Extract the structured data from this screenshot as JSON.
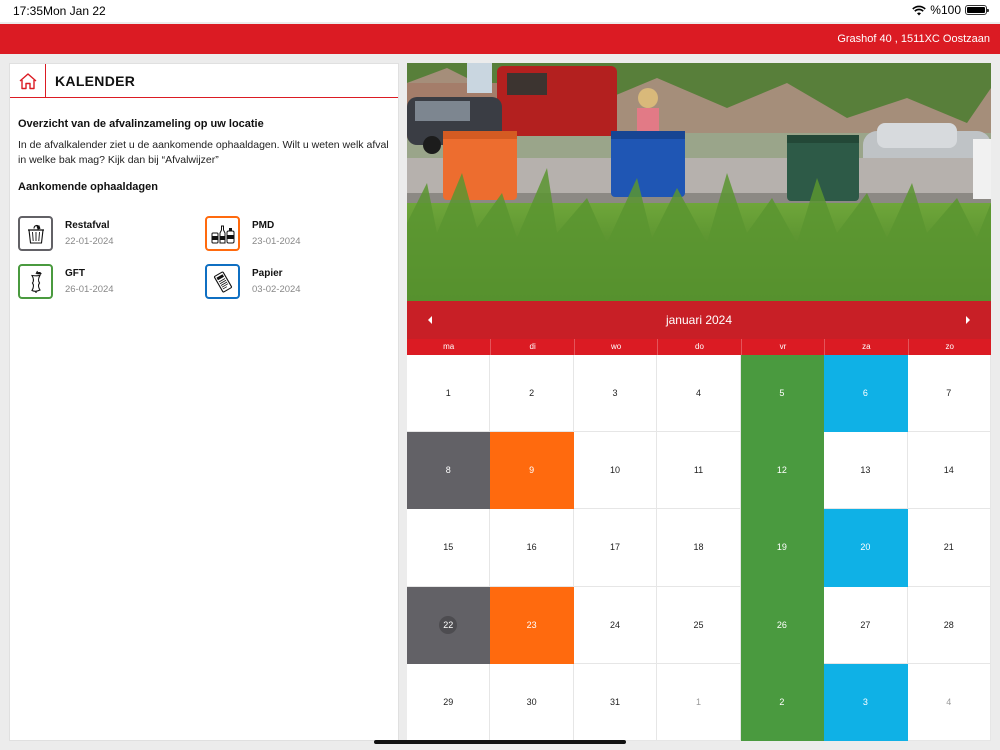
{
  "status_bar": {
    "time": "17:35",
    "date": "Mon Jan 22",
    "battery": "%100"
  },
  "top_bar": {
    "address": "Grashof 40 , 1511XC Oostzaan"
  },
  "page": {
    "title": "KALENDER"
  },
  "intro": {
    "heading": "Overzicht van de afvalinzameling op uw locatie",
    "text": "In de afvalkalender ziet u de aankomende ophaaldagen. Wilt u weten welk afval in welke bak mag? Kijk dan bij “Afvalwijzer”"
  },
  "upcoming": {
    "heading": "Aankomende ophaaldagen",
    "items": [
      {
        "name": "Restafval",
        "date": "22-01-2024",
        "color": "#626166",
        "icon": "trash-bin-icon"
      },
      {
        "name": "PMD",
        "date": "23-01-2024",
        "color": "#ff6a0e",
        "icon": "bottles-icon"
      },
      {
        "name": "GFT",
        "date": "26-01-2024",
        "color": "#4a9a3f",
        "icon": "apple-core-icon"
      },
      {
        "name": "Papier",
        "date": "03-02-2024",
        "color": "#0f6fc2",
        "icon": "paper-icon"
      }
    ]
  },
  "calendar": {
    "month": "januari 2024",
    "weekdays": [
      "ma",
      "di",
      "wo",
      "do",
      "vr",
      "za",
      "zo"
    ],
    "colors": {
      "header": "#c81f26",
      "gft": "#4a9a3f",
      "papier": "#0fb1e6",
      "restafval": "#626166",
      "pmd": "#ff6a0e"
    },
    "days": [
      {
        "d": "1"
      },
      {
        "d": "2"
      },
      {
        "d": "3"
      },
      {
        "d": "4"
      },
      {
        "d": "5",
        "t": "green"
      },
      {
        "d": "6",
        "t": "blue"
      },
      {
        "d": "7"
      },
      {
        "d": "8",
        "t": "gray"
      },
      {
        "d": "9",
        "t": "orange"
      },
      {
        "d": "10"
      },
      {
        "d": "11"
      },
      {
        "d": "12",
        "t": "green"
      },
      {
        "d": "13"
      },
      {
        "d": "14"
      },
      {
        "d": "15"
      },
      {
        "d": "16"
      },
      {
        "d": "17"
      },
      {
        "d": "18"
      },
      {
        "d": "19",
        "t": "green"
      },
      {
        "d": "20",
        "t": "blue"
      },
      {
        "d": "21"
      },
      {
        "d": "22",
        "t": "gray",
        "today": true
      },
      {
        "d": "23",
        "t": "orange"
      },
      {
        "d": "24"
      },
      {
        "d": "25"
      },
      {
        "d": "26",
        "t": "green"
      },
      {
        "d": "27"
      },
      {
        "d": "28"
      },
      {
        "d": "29"
      },
      {
        "d": "30"
      },
      {
        "d": "31"
      },
      {
        "d": "1",
        "other": true
      },
      {
        "d": "2",
        "t": "green",
        "other": true
      },
      {
        "d": "3",
        "t": "blue",
        "other": true
      },
      {
        "d": "4",
        "other": true
      }
    ]
  }
}
